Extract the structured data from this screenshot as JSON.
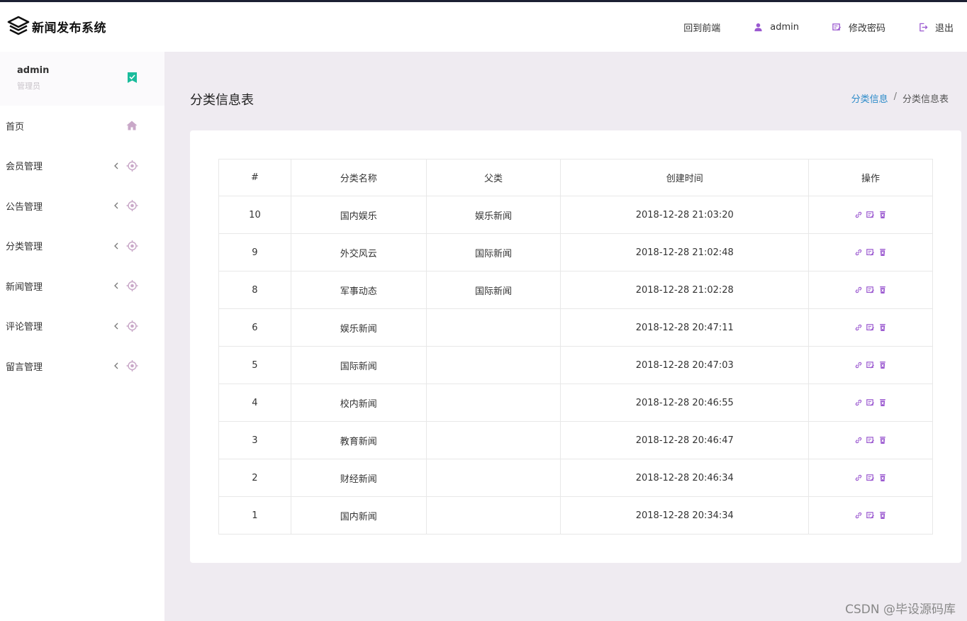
{
  "app": {
    "title": "新闻发布系统"
  },
  "header": {
    "nav": [
      {
        "label": "回到前端",
        "icon": ""
      },
      {
        "label": "admin",
        "icon": "user-icon"
      },
      {
        "label": "修改密码",
        "icon": "edit-icon"
      },
      {
        "label": "退出",
        "icon": "logout-icon"
      }
    ]
  },
  "sidebar": {
    "user": {
      "name": "admin",
      "role": "管理员"
    },
    "items": [
      {
        "label": "首页",
        "icon": "home-icon"
      },
      {
        "label": "会员管理",
        "icon": "target-icon"
      },
      {
        "label": "公告管理",
        "icon": "target-icon"
      },
      {
        "label": "分类管理",
        "icon": "target-icon"
      },
      {
        "label": "新闻管理",
        "icon": "target-icon"
      },
      {
        "label": "评论管理",
        "icon": "target-icon"
      },
      {
        "label": "留言管理",
        "icon": "target-icon"
      }
    ]
  },
  "main": {
    "title": "分类信息表",
    "breadcrumb": {
      "link": "分类信息",
      "separator": "/",
      "current": "分类信息表"
    }
  },
  "table": {
    "headers": [
      "#",
      "分类名称",
      "父类",
      "创建时间",
      "操作"
    ],
    "rows": [
      {
        "id": "10",
        "name": "国内娱乐",
        "parent": "娱乐新闻",
        "created": "2018-12-28 21:03:20"
      },
      {
        "id": "9",
        "name": "外交风云",
        "parent": "国际新闻",
        "created": "2018-12-28 21:02:48"
      },
      {
        "id": "8",
        "name": "军事动态",
        "parent": "国际新闻",
        "created": "2018-12-28 21:02:28"
      },
      {
        "id": "6",
        "name": "娱乐新闻",
        "parent": "",
        "created": "2018-12-28 20:47:11"
      },
      {
        "id": "5",
        "name": "国际新闻",
        "parent": "",
        "created": "2018-12-28 20:47:03"
      },
      {
        "id": "4",
        "name": "校内新闻",
        "parent": "",
        "created": "2018-12-28 20:46:55"
      },
      {
        "id": "3",
        "name": "教育新闻",
        "parent": "",
        "created": "2018-12-28 20:46:47"
      },
      {
        "id": "2",
        "name": "财经新闻",
        "parent": "",
        "created": "2018-12-28 20:46:34"
      },
      {
        "id": "1",
        "name": "国内新闻",
        "parent": "",
        "created": "2018-12-28 20:34:34"
      }
    ]
  },
  "watermark": "CSDN @毕设源码库",
  "colors": {
    "accent": "#9b59d0",
    "link": "#2c8bc9",
    "badge": "#1abc9c",
    "icon_muted": "#c9a8c8"
  }
}
